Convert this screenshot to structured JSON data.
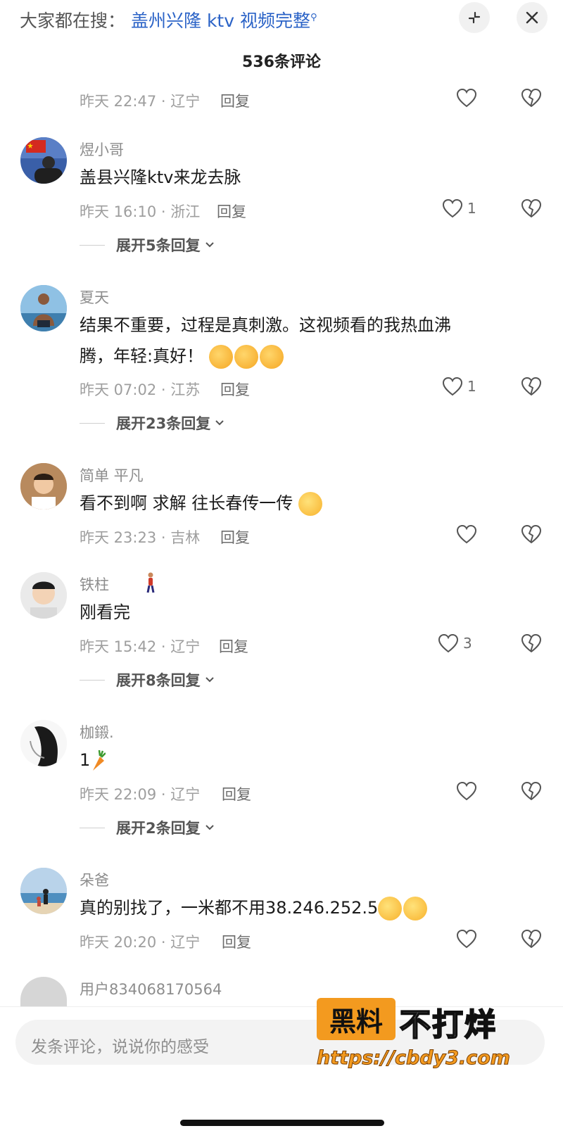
{
  "header": {
    "search_prefix": "大家都在搜：",
    "search_term": "盖州兴隆 ktv 视频完整",
    "collapse_icon": "collapse-icon",
    "close_icon": "close-icon"
  },
  "comment_count": "536条评论",
  "reply_label": "回复",
  "expand_chevron": "chevron-down-icon",
  "top_partial": {
    "meta": "昨天 22:47 · 辽宁"
  },
  "comments": [
    {
      "user": "煜小哥",
      "text": "盖县兴隆ktv来龙去脉",
      "meta": "昨天 16:10 · 浙江",
      "likes": "1",
      "expand": "展开5条回复"
    },
    {
      "user": "夏天",
      "text_line1": "结果不重要，过程是真刺激。这视频看的我热血沸",
      "text_line2": "腾，年轻:真好！",
      "meta": "昨天 07:02 · 江苏",
      "likes": "1",
      "expand": "展开23条回复"
    },
    {
      "user": "简单 平凡",
      "text": "看不到啊 求解  往长春传一传",
      "meta": "昨天 23:23 · 吉林",
      "likes": ""
    },
    {
      "user": "铁柱",
      "text": "刚看完",
      "meta": "昨天 15:42 · 辽宁",
      "likes": "3",
      "expand": "展开8条回复"
    },
    {
      "user": "枷鎩.",
      "text": "1",
      "meta": "昨天 22:09 · 辽宁",
      "likes": "",
      "expand": "展开2条回复"
    },
    {
      "user": "朵爸",
      "text": "真的别找了，一米都不用38.246.252.5",
      "meta": "昨天 20:20 · 辽宁",
      "likes": ""
    },
    {
      "user": "用户834068170564"
    }
  ],
  "input": {
    "placeholder": "发条评论，说说你的感受"
  },
  "watermark": {
    "box": "黑料",
    "text": "不打烊",
    "url": "https://cbdy3.com"
  },
  "colors": {
    "link": "#2b63c7",
    "watermark": "#f39a1f",
    "muted": "#9e9e9e"
  }
}
